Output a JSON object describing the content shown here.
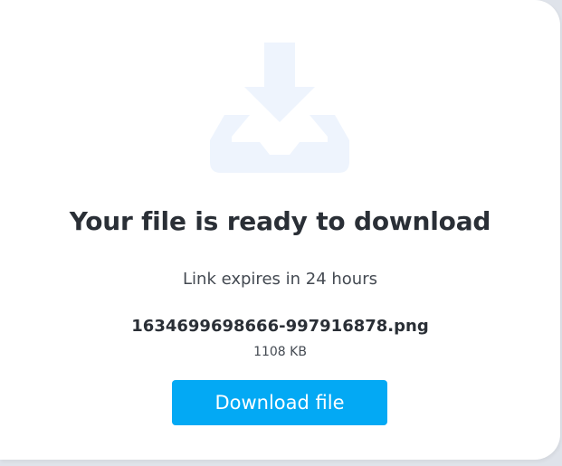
{
  "card": {
    "icon": "download-tray-icon",
    "icon_color": "#eef4fd",
    "title": "Your file is ready to download",
    "subtitle": "Link expires in 24 hours",
    "file": {
      "name": "1634699698666-997916878.png",
      "size": "1108 KB"
    },
    "download_label": "Download file",
    "accent_color": "#03a9f4"
  }
}
